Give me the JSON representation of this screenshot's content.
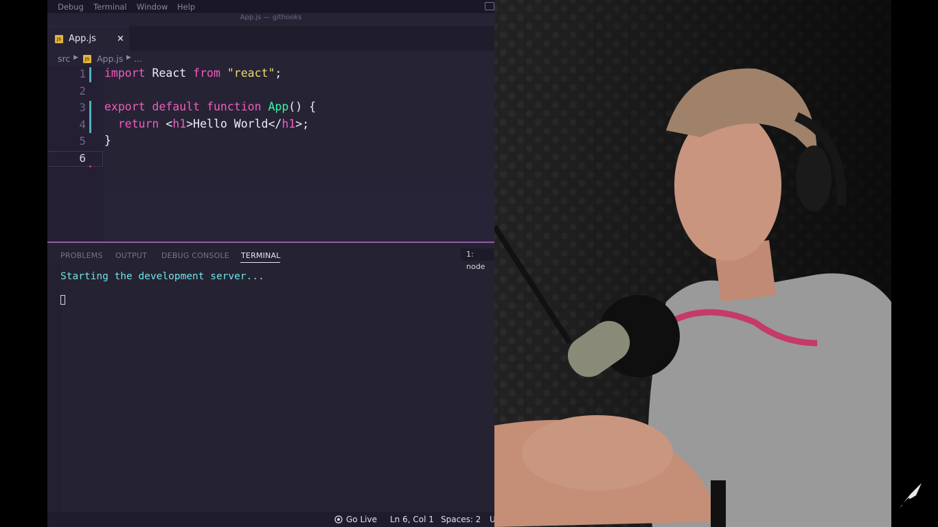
{
  "menubar": {
    "items": [
      "Debug",
      "Terminal",
      "Window",
      "Help"
    ]
  },
  "window": {
    "title": "App.js — githooks"
  },
  "tab": {
    "label": "App.js",
    "close": "×",
    "badge": "JS"
  },
  "breadcrumb": {
    "folder": "src",
    "file": "App.js",
    "more": "..."
  },
  "editor": {
    "line_numbers": [
      "1",
      "2",
      "3",
      "4",
      "5",
      "6"
    ],
    "current_line": "6",
    "lines": [
      [
        {
          "t": "import",
          "c": "k"
        },
        {
          "t": " React ",
          "c": ""
        },
        {
          "t": "from",
          "c": "k"
        },
        {
          "t": " ",
          "c": ""
        },
        {
          "t": "\"react\"",
          "c": "s"
        },
        {
          "t": ";",
          "c": ""
        }
      ],
      [],
      [
        {
          "t": "export",
          "c": "k"
        },
        {
          "t": " ",
          "c": ""
        },
        {
          "t": "default",
          "c": "k"
        },
        {
          "t": " ",
          "c": ""
        },
        {
          "t": "function",
          "c": "k"
        },
        {
          "t": " ",
          "c": ""
        },
        {
          "t": "App",
          "c": "f"
        },
        {
          "t": "() {",
          "c": ""
        }
      ],
      [
        {
          "t": "  ",
          "c": ""
        },
        {
          "t": "return",
          "c": "k"
        },
        {
          "t": " <",
          "c": ""
        },
        {
          "t": "h1",
          "c": "t"
        },
        {
          "t": ">Hello World</",
          "c": ""
        },
        {
          "t": "h1",
          "c": "t"
        },
        {
          "t": ">;",
          "c": ""
        }
      ],
      [
        {
          "t": "}",
          "c": ""
        }
      ],
      []
    ]
  },
  "panel": {
    "tabs": [
      "PROBLEMS",
      "OUTPUT",
      "DEBUG CONSOLE",
      "TERMINAL"
    ],
    "active_tab": "TERMINAL",
    "terminal_select": "1: node",
    "terminal_output": "Starting the development server..."
  },
  "statusbar": {
    "go_live": "Go Live",
    "position": "Ln 6, Col 1",
    "spaces": "Spaces: 2",
    "encoding": "U"
  },
  "colors": {
    "editor_bg": "#262335",
    "keyword": "#f05dbe",
    "string": "#f1d96e",
    "function": "#36f9a5",
    "terminal_text": "#6fe3e8",
    "panel_border": "#8d5ea8"
  }
}
